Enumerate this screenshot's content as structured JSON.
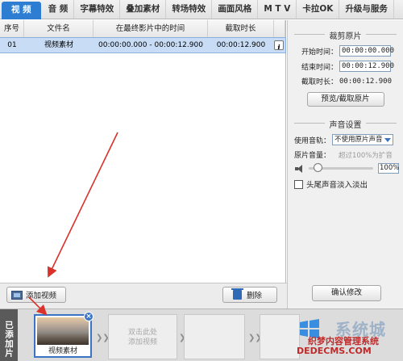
{
  "tabs": [
    "视 频",
    "音 频",
    "字幕特效",
    "叠加素材",
    "转场特效",
    "画面风格",
    "M T V",
    "卡拉OK",
    "升级与服务"
  ],
  "list": {
    "headers": [
      "序号",
      "文件名",
      "在最终影片中的时间",
      "截取时长"
    ],
    "rows": [
      {
        "index": "01",
        "name": "视频素材",
        "time": "00:00:00.000 - 00:00:12.900",
        "duration": "00:00:12.900"
      }
    ]
  },
  "crop": {
    "title": "裁剪原片",
    "start_label": "开始时间：",
    "start_value": "00:00:00.000",
    "end_label": "结束时间：",
    "end_value": "00:00:12.900",
    "duration_label": "截取时长：",
    "duration_value": "00:00:12.900",
    "preview_button": "预览/截取原片"
  },
  "audio": {
    "title": "声音设置",
    "track_label": "使用音轨：",
    "track_value": "不使用原片声音",
    "volume_label": "原片音量：",
    "volume_hint": "超过100%为扩音",
    "volume_value": "100%",
    "volume_level": 0.1,
    "fade_label": "头尾声音淡入淡出"
  },
  "confirm_button": "确认修改",
  "toolbar": {
    "add_label": "添加视频",
    "delete_label": "删除"
  },
  "strip": {
    "label": "已添加片段",
    "clip_name": "视频素材",
    "empty_hint_1": "双击此处",
    "empty_hint_2": "添加视频"
  },
  "watermark": {
    "title": "系统城",
    "cn": "织梦内容管理系统",
    "en": "DEDECMS.COM"
  },
  "colors": {
    "accent": "#2d7dd2",
    "annotation": "#d9312b"
  }
}
